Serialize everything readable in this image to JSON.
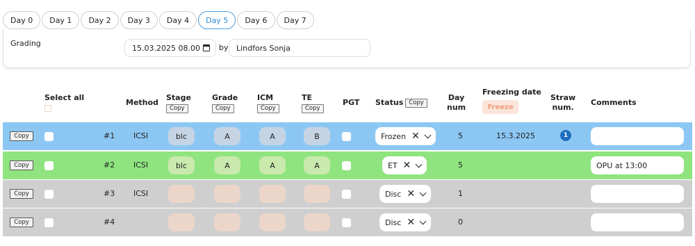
{
  "tabs": [
    "Day 0",
    "Day 1",
    "Day 2",
    "Day 3",
    "Day 4",
    "Day 5",
    "Day 6",
    "Day 7"
  ],
  "active_tab": "Day 5",
  "grading": {
    "label": "Grading",
    "datetime": "15.03.2025 08.00",
    "by_label": "by",
    "user": "Lindfors Sonja"
  },
  "columns": {
    "select_all": "Select all",
    "method": "Method",
    "stage": "Stage",
    "grade": "Grade",
    "icm": "ICM",
    "te": "TE",
    "pgt": "PGT",
    "status": "Status",
    "day_num_1": "Day",
    "day_num_2": "num",
    "freezing_date": "Freezing date",
    "freeze_button": "Freeze",
    "straw_1": "Straw",
    "straw_2": "num.",
    "comments": "Comments",
    "copy_label": "Copy"
  },
  "rows": [
    {
      "copy": "Copy",
      "num": "#1",
      "method": "ICSI",
      "stage": "blc",
      "grade": "A",
      "icm": "A",
      "te": "B",
      "status": "Frozen",
      "day": "5",
      "freezing_date": "15.3.2025",
      "straw": "1",
      "comment": "",
      "color": "#8cc7f4"
    },
    {
      "copy": "Copy",
      "num": "#2",
      "method": "ICSI",
      "stage": "blc",
      "grade": "A",
      "icm": "A",
      "te": "A",
      "status": "ET",
      "day": "5",
      "freezing_date": "",
      "straw": "",
      "comment": "OPU at 13:00",
      "color": "#8fe47f"
    },
    {
      "copy": "Copy",
      "num": "#3",
      "method": "ICSI",
      "stage": "",
      "grade": "",
      "icm": "",
      "te": "",
      "status": "Disc",
      "day": "1",
      "freezing_date": "",
      "straw": "",
      "comment": "",
      "color": "#cfcfcf"
    },
    {
      "copy": "Copy",
      "num": "#4",
      "method": "",
      "stage": "",
      "grade": "",
      "icm": "",
      "te": "",
      "status": "Disc",
      "day": "0",
      "freezing_date": "",
      "straw": "",
      "comment": "",
      "color": "#cfcfcf"
    }
  ],
  "icons": {
    "calendar": "calendar-icon",
    "clear": "close-icon",
    "dropdown": "chevron-down-icon"
  }
}
